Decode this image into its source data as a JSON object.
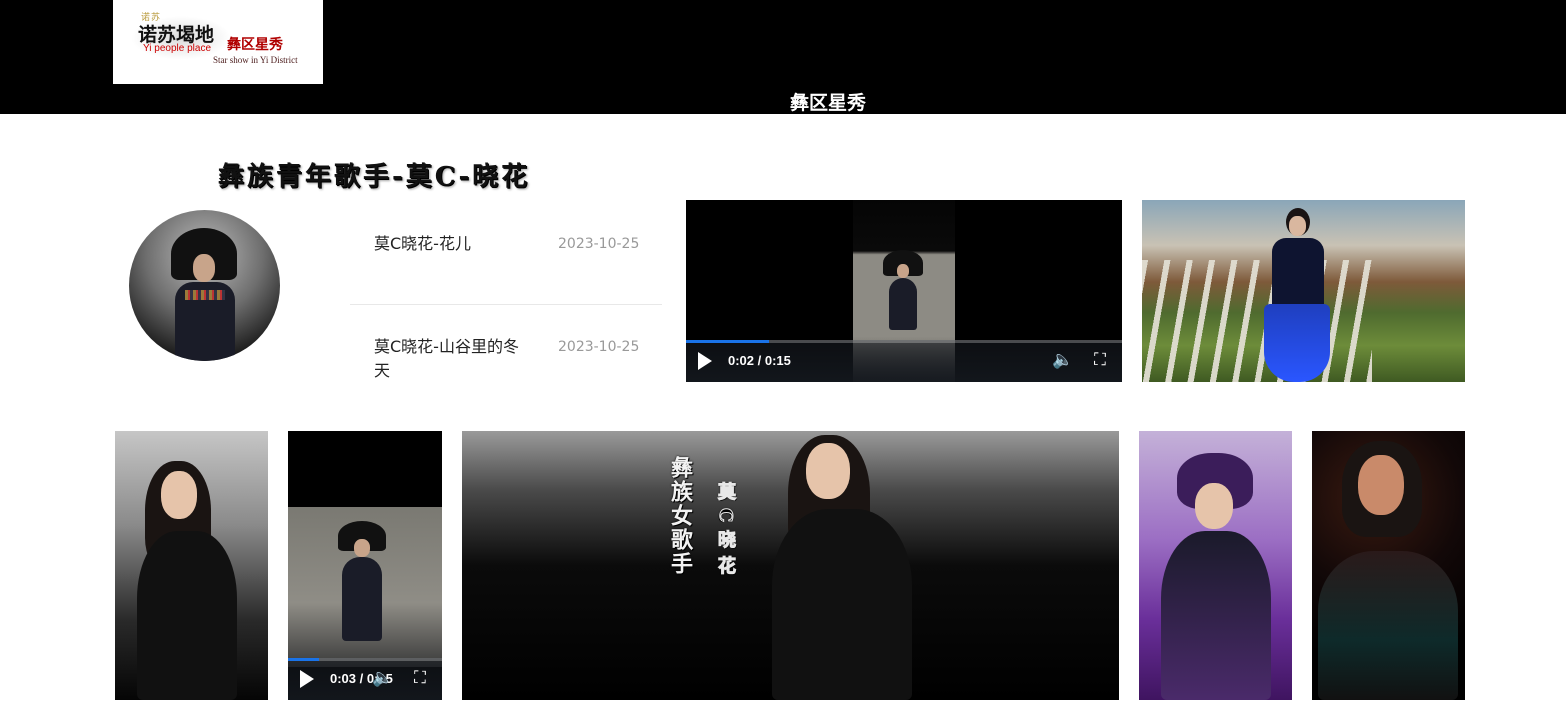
{
  "header": {
    "logo": {
      "top_text": "诺苏",
      "cn_name": "诺苏堨地",
      "en_name": "Yi people place",
      "red_title": "彝区星秀",
      "star_show": "Star show in Yi District"
    },
    "nav_title": "彝区星秀"
  },
  "section": {
    "title": "彝族青年歌手-莫C-晓花"
  },
  "list": {
    "items": [
      {
        "title": "莫C晓花-花儿",
        "date": "2023-10-25"
      },
      {
        "title": "莫C晓花-山谷里的冬天",
        "date": "2023-10-25"
      }
    ]
  },
  "videos": {
    "main": {
      "time": "0:02 / 0:15",
      "progress": 0.19
    },
    "small": {
      "time": "0:03 / 0:15",
      "progress": 0.2
    }
  },
  "banner": {
    "vertical_text_1": "彝族女歌手",
    "vertical_text_2": "莫C晓花"
  },
  "icons": {
    "play": "play-icon",
    "volume": "volume-icon",
    "fullscreen": "fullscreen-icon"
  },
  "colors": {
    "header_bg": "#000000",
    "progress": "#1a73e8",
    "date": "#999999"
  }
}
